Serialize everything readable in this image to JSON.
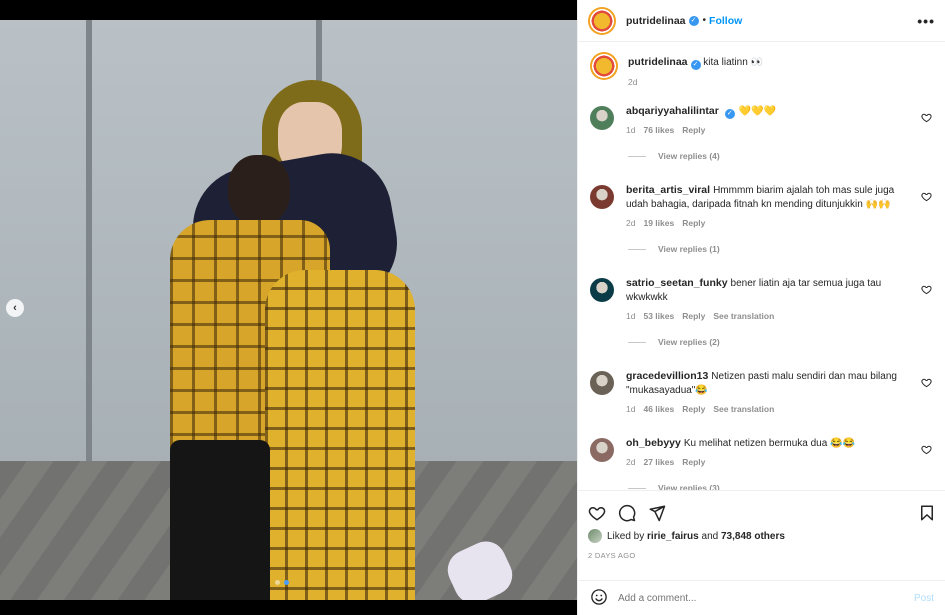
{
  "post": {
    "username": "putridelinaa",
    "follow_label": "Follow",
    "separator": "•",
    "caption": "kita liatinn 👀",
    "caption_time": "2d",
    "more_label": "•••"
  },
  "comments": [
    {
      "username": "abqariyyahalilintar",
      "verified": true,
      "text": "💛💛💛",
      "time": "1d",
      "likes": "76 likes",
      "reply": "Reply",
      "translation": "",
      "view_replies": "View replies (4)",
      "avatar_color": "#4f7e5a"
    },
    {
      "username": "berita_artis_viral",
      "verified": false,
      "text": "Hmmmm biarim ajalah toh mas sule juga udah bahagia, daripada fitnah kn mending ditunjukkin 🙌🙌",
      "time": "2d",
      "likes": "19 likes",
      "reply": "Reply",
      "translation": "",
      "view_replies": "View replies (1)",
      "avatar_color": "#7b3a30"
    },
    {
      "username": "satrio_seetan_funky",
      "verified": false,
      "text": "bener liatin aja tar semua juga tau wkwkwkk",
      "time": "1d",
      "likes": "53 likes",
      "reply": "Reply",
      "translation": "See translation",
      "view_replies": "View replies (2)",
      "avatar_color": "#0b3b46"
    },
    {
      "username": "gracedevillion13",
      "verified": false,
      "text": "Netizen pasti malu sendiri dan mau bilang \"mukasayadua\"😂",
      "time": "1d",
      "likes": "46 likes",
      "reply": "Reply",
      "translation": "See translation",
      "view_replies": "",
      "avatar_color": "#6b6257"
    },
    {
      "username": "oh_bebyyy",
      "verified": false,
      "text": "Ku melihat netizen bermuka dua 😂😂",
      "time": "2d",
      "likes": "27 likes",
      "reply": "Reply",
      "translation": "",
      "view_replies": "View replies (3)",
      "avatar_color": "#8a6a63"
    }
  ],
  "likes": {
    "prefix": "Liked by",
    "first_user": "ririe_fairus",
    "and": "and",
    "others": "73,848 others"
  },
  "date": "2 DAYS AGO",
  "add_comment": {
    "placeholder": "Add a comment...",
    "post_label": "Post"
  },
  "carousel": {
    "prev_label": "‹"
  }
}
